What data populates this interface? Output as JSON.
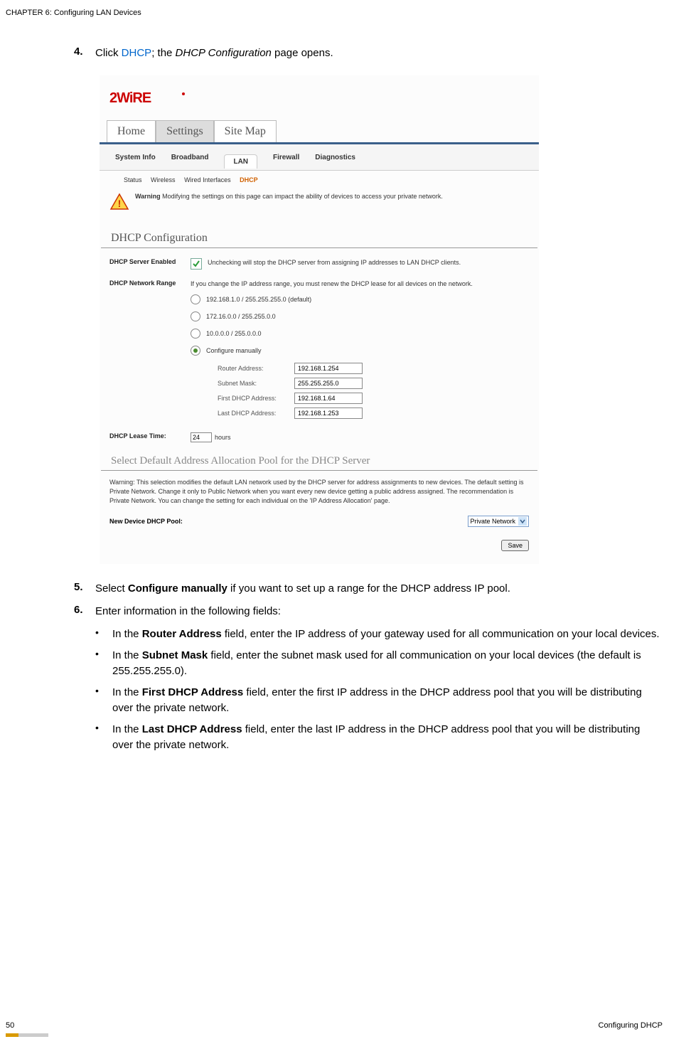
{
  "header": {
    "chapter": "CHAPTER 6: Configuring LAN Devices"
  },
  "steps": {
    "s4": {
      "num": "4.",
      "pre": "Click ",
      "link": "DHCP",
      "mid": "; the ",
      "ital": "DHCP Configuration",
      "post": " page opens."
    },
    "s5": {
      "num": "5.",
      "pre": "Select ",
      "bold": "Configure manually",
      "post": " if you want to set up a range for the DHCP address IP pool."
    },
    "s6": {
      "num": "6.",
      "text": "Enter information in the following fields:"
    }
  },
  "bullets": {
    "b1": {
      "pre": "In the ",
      "bold": "Router Address",
      "post": " field, enter the IP address of your gateway used for all communication on your local devices."
    },
    "b2": {
      "pre": "In the ",
      "bold": "Subnet Mask",
      "post": " field, enter the subnet mask used for all communication on your local devices (the default is 255.255.255.0)."
    },
    "b3": {
      "pre": "In the ",
      "bold": "First DHCP Address",
      "post": " field, enter the first IP address in the DHCP address pool that you will be distributing over the private network."
    },
    "b4": {
      "pre": "In the ",
      "bold": "Last DHCP Address",
      "post": " field, enter the last IP address in the DHCP address pool that you will be distributing over the private network."
    }
  },
  "screenshot": {
    "tabs": {
      "home": "Home",
      "settings": "Settings",
      "sitemap": "Site Map"
    },
    "subtabs": {
      "sys": "System Info",
      "bb": "Broadband",
      "lan": "LAN",
      "fw": "Firewall",
      "diag": "Diagnostics"
    },
    "tertiary": {
      "status": "Status",
      "wireless": "Wireless",
      "wired": "Wired Interfaces",
      "dhcp": "DHCP"
    },
    "warning": {
      "label": "Warning",
      "text": " Modifying the settings on this page can impact the ability of devices to access your private network."
    },
    "section1": "DHCP Configuration",
    "server_enabled": {
      "label": "DHCP Server Enabled",
      "desc": "Unchecking will stop the DHCP server from assigning IP addresses to LAN DHCP clients."
    },
    "network_range": {
      "label": "DHCP Network Range",
      "desc": "If you change the IP address range, you must renew the DHCP lease for all devices on the network."
    },
    "radio1": "192.168.1.0 / 255.255.255.0 (default)",
    "radio2": "172.16.0.0 / 255.255.0.0",
    "radio3": "10.0.0.0 / 255.0.0.0",
    "radio4": "Configure manually",
    "manual": {
      "router_l": "Router Address:",
      "router_v": "192.168.1.254",
      "subnet_l": "Subnet Mask:",
      "subnet_v": "255.255.255.0",
      "first_l": "First DHCP Address:",
      "first_v": "192.168.1.64",
      "last_l": "Last DHCP Address:",
      "last_v": "192.168.1.253"
    },
    "lease": {
      "label": "DHCP Lease Time:",
      "value": "24",
      "unit": "hours"
    },
    "section2": "Select Default Address Allocation Pool for the DHCP Server",
    "warning2": "Warning: This selection modifies the default LAN network used by the DHCP server for address assignments to new devices. The default setting is Private Network. Change it only to Public Network when you want every new device getting a public address assigned. The recommendation is Private Network. You can change the setting for each individual on the 'IP Address Allocation' page.",
    "pool": {
      "label": "New Device DHCP Pool:",
      "value": "Private Network"
    },
    "save": "Save"
  },
  "footer": {
    "page": "50",
    "section": "Configuring DHCP"
  }
}
